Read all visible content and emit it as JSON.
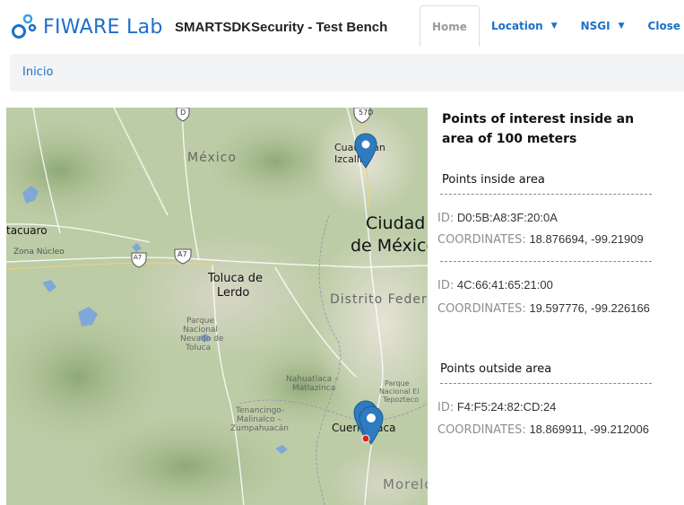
{
  "brand": {
    "name": "FIWARE Lab"
  },
  "app_title": "SMARTSDKSecurity - Test Bench",
  "nav": {
    "tabs": [
      {
        "label": "Home",
        "active": true
      },
      {
        "label": "Location",
        "dropdown": true
      },
      {
        "label": "NSGI",
        "dropdown": true
      },
      {
        "label": "Close"
      }
    ]
  },
  "breadcrumb": {
    "label": "Inicio"
  },
  "map": {
    "labels": {
      "mexico_state": "México",
      "cuautitlan": "Cuautitlán Izcalli",
      "ciudad": "Ciudad",
      "de_mexico": "de México",
      "distrito": "Distrito Federal",
      "tacuaro": "tacuaro",
      "zona_nucleo": "Zona Núcleo",
      "toluca_1": "Toluca de",
      "toluca_2": "Lerdo",
      "parque_1": "Parque",
      "parque_2": "Nacional",
      "parque_3": "Nevado de",
      "parque_4": "Toluca",
      "nahuatlaca_1": "Nahuatlaca –",
      "nahuatlaca_2": "Matlazinca",
      "tenancingo_1": "Tenancingo-",
      "tenancingo_2": "Malinalco –",
      "tenancingo_3": "Zumpahuacán",
      "pn_tepozteco_1": "Parque",
      "pn_tepozteco_2": "Nacional El",
      "pn_tepozteco_3": "Tepozteco",
      "cuernavaca": "Cuernavaca",
      "morelos": "Morelos",
      "shield_57d": "57D",
      "shield_d": "D",
      "shield_a7": "A7"
    },
    "colors": {
      "water": "#7fa8d6",
      "pin": "#2f7bbf",
      "marker_red": "#e02020"
    }
  },
  "panel": {
    "title": "Points of interest inside an area of 100 meters",
    "inside_title": "Points inside area",
    "outside_title": "Points outside area",
    "id_label": "ID:",
    "coord_label": "COORDINATES:",
    "inside_points": [
      {
        "id": "D0:5B:A8:3F:20:0A",
        "coordinates": "18.876694, -99.21909"
      },
      {
        "id": "4C:66:41:65:21:00",
        "coordinates": "19.597776, -99.226166"
      }
    ],
    "outside_points": [
      {
        "id": "F4:F5:24:82:CD:24",
        "coordinates": "18.869911, -99.212006"
      }
    ],
    "separator": "-------------------------------------------"
  }
}
